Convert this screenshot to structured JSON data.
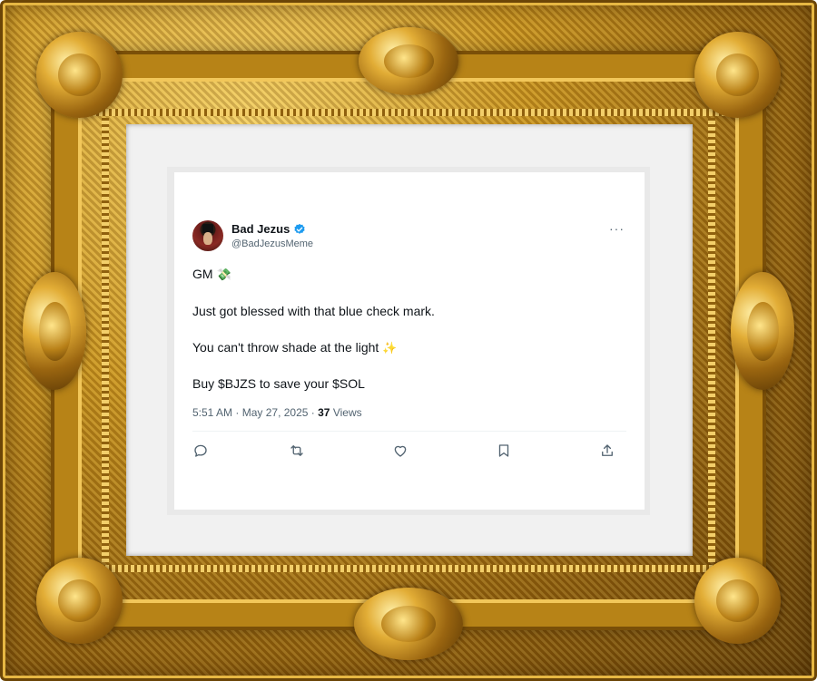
{
  "tweet": {
    "display_name": "Bad Jezus",
    "handle": "@BadJezusMeme",
    "more_label": "···",
    "lines": [
      {
        "text": "GM",
        "emoji": "💸"
      },
      {
        "text": "Just got blessed with that blue check mark.",
        "emoji": ""
      },
      {
        "text": "You can't throw shade at the light",
        "emoji": "✨"
      },
      {
        "text": "Buy $BJZS to save your $SOL",
        "emoji": ""
      }
    ],
    "time": "5:51 AM",
    "separator": "·",
    "date": "May 27, 2025",
    "views_count": "37",
    "views_label": "Views"
  },
  "icons": {
    "verified": "verified-badge-icon",
    "reply": "reply-icon",
    "retweet": "retweet-icon",
    "like": "heart-icon",
    "bookmark": "bookmark-icon",
    "share": "share-icon"
  },
  "colors": {
    "verified": "#1d9bf0",
    "text": "#0f1419",
    "muted": "#536471",
    "frame_gold": "#c9931e"
  }
}
